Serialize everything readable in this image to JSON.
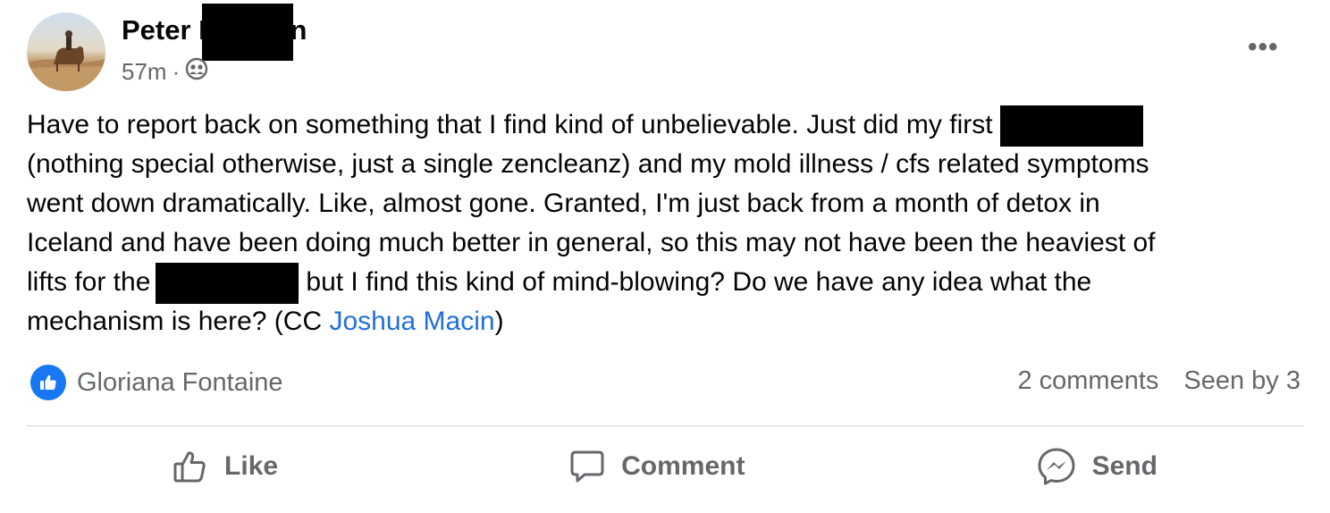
{
  "post": {
    "author_visible": "Peter B",
    "author_suffix": "n",
    "timestamp": "57m",
    "separator": "·",
    "audience_icon": "group-icon",
    "more_icon": "more-options-icon",
    "body": {
      "line1": "Have to report back on something that I find kind of unbelievable. Just did my first",
      "line2": "(nothing special otherwise, just a single zencleanz) and my mold illness / cfs related symptoms",
      "line3": "went down dramatically. Like, almost gone. Granted, I'm just back from a month of detox in",
      "line4": "Iceland and have been doing much better in general, so this may not have been the heaviest of",
      "line5a": "lifts for the",
      "line5b": "but I find this kind of mind-blowing? Do we have any idea what the",
      "line6a": "mechanism is here? (CC",
      "mention": "Joshua Macin",
      "line6b": ")"
    },
    "reaction": {
      "icon": "like-reaction-icon",
      "name": "Gloriana Fontaine",
      "color": "#1877f2"
    },
    "stats": {
      "comments": "2 comments",
      "seen": "Seen by 3"
    },
    "actions": {
      "like": "Like",
      "comment": "Comment",
      "send": "Send"
    }
  }
}
